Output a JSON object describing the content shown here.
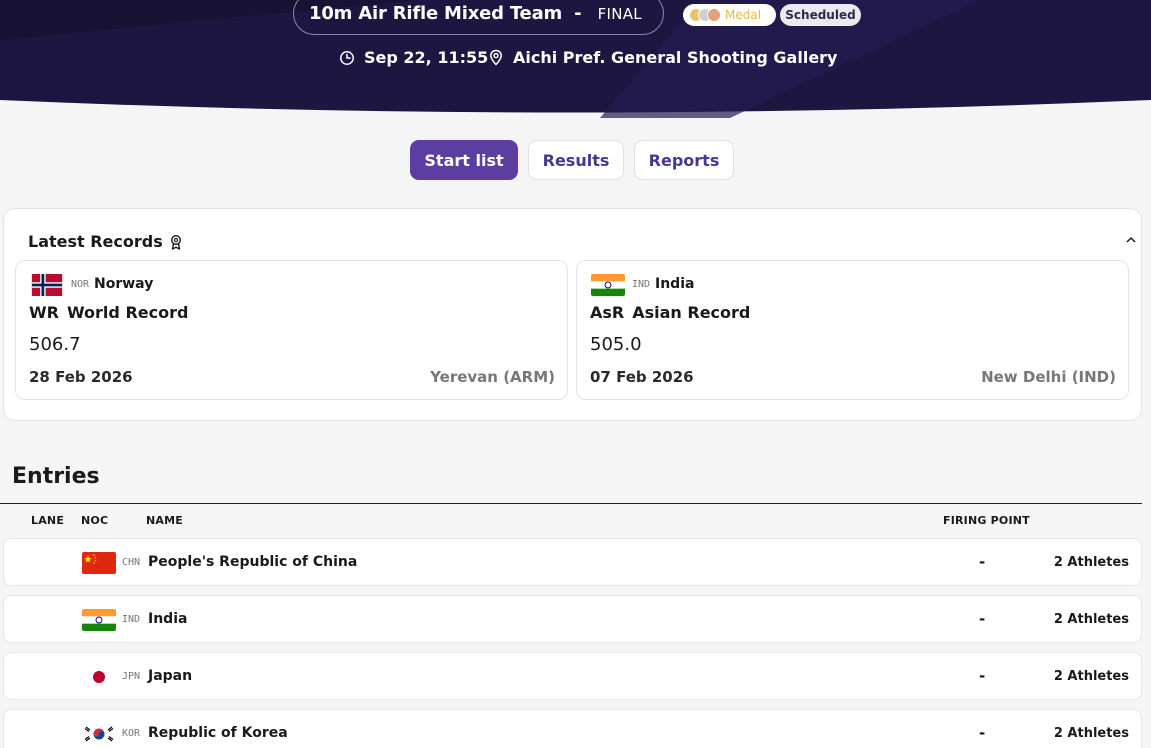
{
  "event": {
    "title": "10m Air Rifle Mixed Team",
    "separator": "-",
    "phase": "FINAL",
    "medal_label": "Medal",
    "status": "Scheduled",
    "datetime": "Sep 22, 11:55",
    "venue": "Aichi Pref. General Shooting Gallery"
  },
  "tabs": [
    {
      "label": "Start list",
      "active": true
    },
    {
      "label": "Results",
      "active": false
    },
    {
      "label": "Reports",
      "active": false
    }
  ],
  "records": {
    "heading": "Latest Records",
    "items": [
      {
        "noc": "NOR",
        "country": "Norway",
        "abbr": "WR",
        "type": "World Record",
        "value": "506.7",
        "date": "28 Feb 2026",
        "place": "Yerevan (ARM)"
      },
      {
        "noc": "IND",
        "country": "India",
        "abbr": "AsR",
        "type": "Asian Record",
        "value": "505.0",
        "date": "07 Feb 2026",
        "place": "New Delhi (IND)"
      }
    ]
  },
  "entries": {
    "title": "Entries",
    "columns": {
      "lane": "LANE",
      "noc": "NOC",
      "name": "NAME",
      "firing_point": "FIRING POINT"
    },
    "rows": [
      {
        "noc": "CHN",
        "name": "People's Republic of China",
        "firing_point": "-",
        "athletes": "2 Athletes"
      },
      {
        "noc": "IND",
        "name": "India",
        "firing_point": "-",
        "athletes": "2 Athletes"
      },
      {
        "noc": "JPN",
        "name": "Japan",
        "firing_point": "-",
        "athletes": "2 Athletes"
      },
      {
        "noc": "KOR",
        "name": "Republic of Korea",
        "firing_point": "-",
        "athletes": "2 Athletes"
      }
    ]
  },
  "colors": {
    "header_bg": "#1c1640",
    "accent": "#5b3ea0",
    "medal_gold": "#e8b84a",
    "medal_silver": "#c9c9c9",
    "medal_bronze": "#e09a6b"
  }
}
